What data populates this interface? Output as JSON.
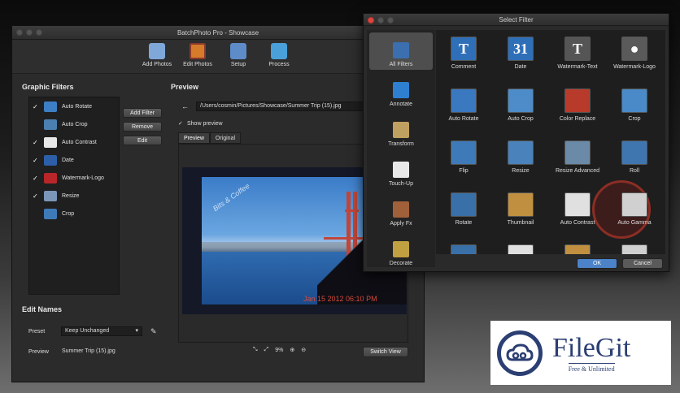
{
  "main_window": {
    "title": "BatchPhoto Pro - Showcase",
    "toolbar": [
      {
        "label": "Add Photos",
        "icon": "folder-photos-icon",
        "color": "#7fa8d8"
      },
      {
        "label": "Edit Photos",
        "icon": "edit-photos-icon",
        "color": "#d67b2a"
      },
      {
        "label": "Setup",
        "icon": "setup-icon",
        "color": "#5e8cc9"
      },
      {
        "label": "Process",
        "icon": "process-icon",
        "color": "#4aa0d8"
      }
    ],
    "graphic_filters": {
      "heading": "Graphic Filters",
      "items": [
        {
          "label": "Auto Rotate",
          "checked": "✓",
          "color": "#3d7fc4"
        },
        {
          "label": "Auto Crop",
          "checked": "",
          "color": "#4a7fb0"
        },
        {
          "label": "Auto Contrast",
          "checked": "✓",
          "color": "#e8e8e8"
        },
        {
          "label": "Date",
          "checked": "✓",
          "color": "#2d5fa8"
        },
        {
          "label": "Watermark-Logo",
          "checked": "✓",
          "color": "#b8262a"
        },
        {
          "label": "Resize",
          "checked": "✓",
          "color": "#7a96b8"
        },
        {
          "label": "Crop",
          "checked": "",
          "color": "#3f7ab8"
        }
      ],
      "buttons": {
        "add": "Add Filter",
        "remove": "Remove",
        "edit": "Edit"
      }
    },
    "preview": {
      "heading": "Preview",
      "back_arrow": "←",
      "path": "/Users/cosmin/Pictures/Showcase/Summer Trip (15).jpg",
      "show_preview_check": "✓",
      "show_preview_label": "Show preview",
      "tabs": [
        "Preview",
        "Original"
      ],
      "watermark": "Bits & Coffee",
      "date_stamp": "Jan 15 2012 06:10 PM",
      "zoom_label": "9%",
      "zoom_fit_glyph": "⤡",
      "zoom_full_glyph": "⤢",
      "zoom_in_glyph": "⊕",
      "zoom_out_glyph": "⊖",
      "switch_view": "Switch View"
    },
    "edit_names": {
      "heading": "Edit Names",
      "preset_label": "Preset",
      "preset_value": "Keep Unchanged",
      "dropdown_glyph": "▾",
      "pencil_glyph": "✎",
      "preview_label": "Preview",
      "preview_value": "Summer Trip (15).jpg"
    }
  },
  "dialog": {
    "title": "Select Filter",
    "categories": [
      {
        "label": "All Filters",
        "color": "#3c6fb0"
      },
      {
        "label": "Annotate",
        "color": "#2f7fd0"
      },
      {
        "label": "Transform",
        "color": "#c0a060"
      },
      {
        "label": "Touch-Up",
        "color": "#e8e8e8"
      },
      {
        "label": "Apply Fx",
        "color": "#a0603a"
      },
      {
        "label": "Decorate",
        "color": "#c0a040"
      }
    ],
    "filters": [
      {
        "label": "Comment",
        "glyph": "T",
        "color": "#2f6fb8"
      },
      {
        "label": "Date",
        "glyph": "31",
        "color": "#2f6fb8"
      },
      {
        "label": "Watermark-Text",
        "glyph": "T",
        "color": "#555555"
      },
      {
        "label": "Watermark-Logo",
        "glyph": "●",
        "color": "#5a5a5a"
      },
      {
        "label": "Auto Rotate",
        "glyph": "",
        "color": "#3a78c0"
      },
      {
        "label": "Auto Crop",
        "glyph": "",
        "color": "#4d8cc8"
      },
      {
        "label": "Color Replace",
        "glyph": "",
        "color": "#b83a2a"
      },
      {
        "label": "Crop",
        "glyph": "",
        "color": "#4a8ac8"
      },
      {
        "label": "Flip",
        "glyph": "",
        "color": "#3f7ab8"
      },
      {
        "label": "Resize",
        "glyph": "",
        "color": "#4a82bc"
      },
      {
        "label": "Resize Advanced",
        "glyph": "",
        "color": "#6a8aa8"
      },
      {
        "label": "Roll",
        "glyph": "",
        "color": "#3f76b0"
      },
      {
        "label": "Rotate",
        "glyph": "",
        "color": "#3a70a8"
      },
      {
        "label": "Thumbnail",
        "glyph": "",
        "color": "#c09040"
      },
      {
        "label": "Auto Contrast",
        "glyph": "",
        "color": "#e0e0e0"
      },
      {
        "label": "Auto Gamma",
        "glyph": "",
        "color": "#d0d0d0"
      },
      {
        "label": "",
        "glyph": "",
        "color": "#3a70a8"
      },
      {
        "label": "",
        "glyph": "",
        "color": "#e0e0e0"
      },
      {
        "label": "",
        "glyph": "",
        "color": "#c09040"
      },
      {
        "label": "",
        "glyph": "",
        "color": "#d0d0d0"
      }
    ],
    "ok": "OK",
    "cancel": "Cancel"
  },
  "logo": {
    "name": "FileGit",
    "tagline": "Free & Unlimited",
    "color": "#2b3f73"
  }
}
